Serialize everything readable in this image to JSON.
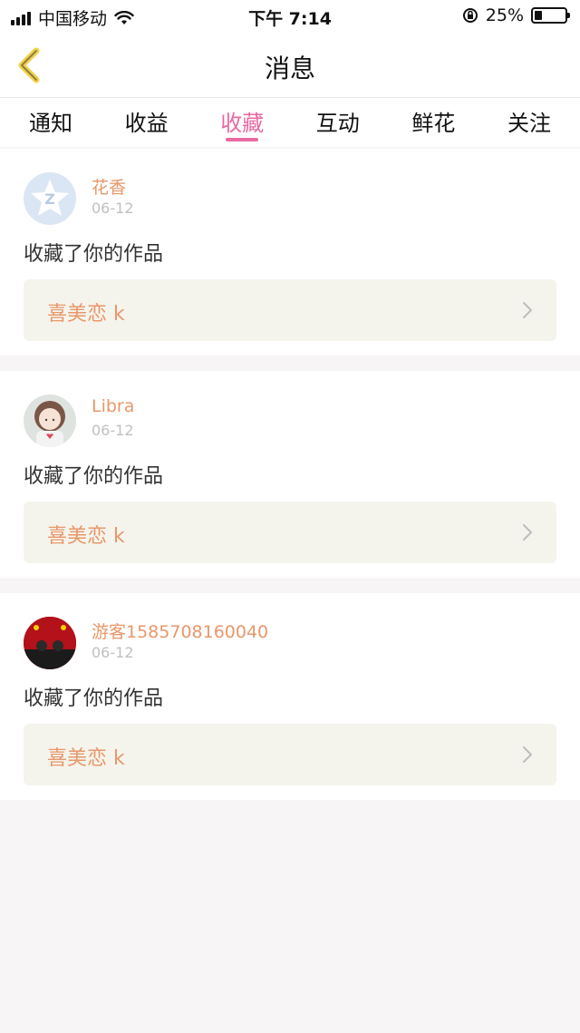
{
  "status_bar": {
    "carrier": "中国移动",
    "time": "下午 7:14",
    "battery": "25%",
    "battery_level": 0.25
  },
  "header": {
    "title": "消息",
    "back_icon": "back-chevron-icon"
  },
  "tabs": [
    {
      "label": "通知",
      "active": false
    },
    {
      "label": "收益",
      "active": false
    },
    {
      "label": "收藏",
      "active": true
    },
    {
      "label": "互动",
      "active": false
    },
    {
      "label": "鲜花",
      "active": false
    },
    {
      "label": "关注",
      "active": false
    }
  ],
  "messages": [
    {
      "name": "花香",
      "date": "06-12",
      "action": "收藏了你的作品",
      "work": "喜美恋 k"
    },
    {
      "name": "Libra",
      "date": "06-12",
      "action": "收藏了你的作品",
      "work": "喜美恋 k"
    },
    {
      "name": "游客1585708160040",
      "date": "06-12",
      "action": "收藏了你的作品",
      "work": "喜美恋 k"
    }
  ],
  "colors": {
    "accent": "#e86aa2",
    "name": "#e8976a",
    "work_bg": "#f5f4ec"
  }
}
